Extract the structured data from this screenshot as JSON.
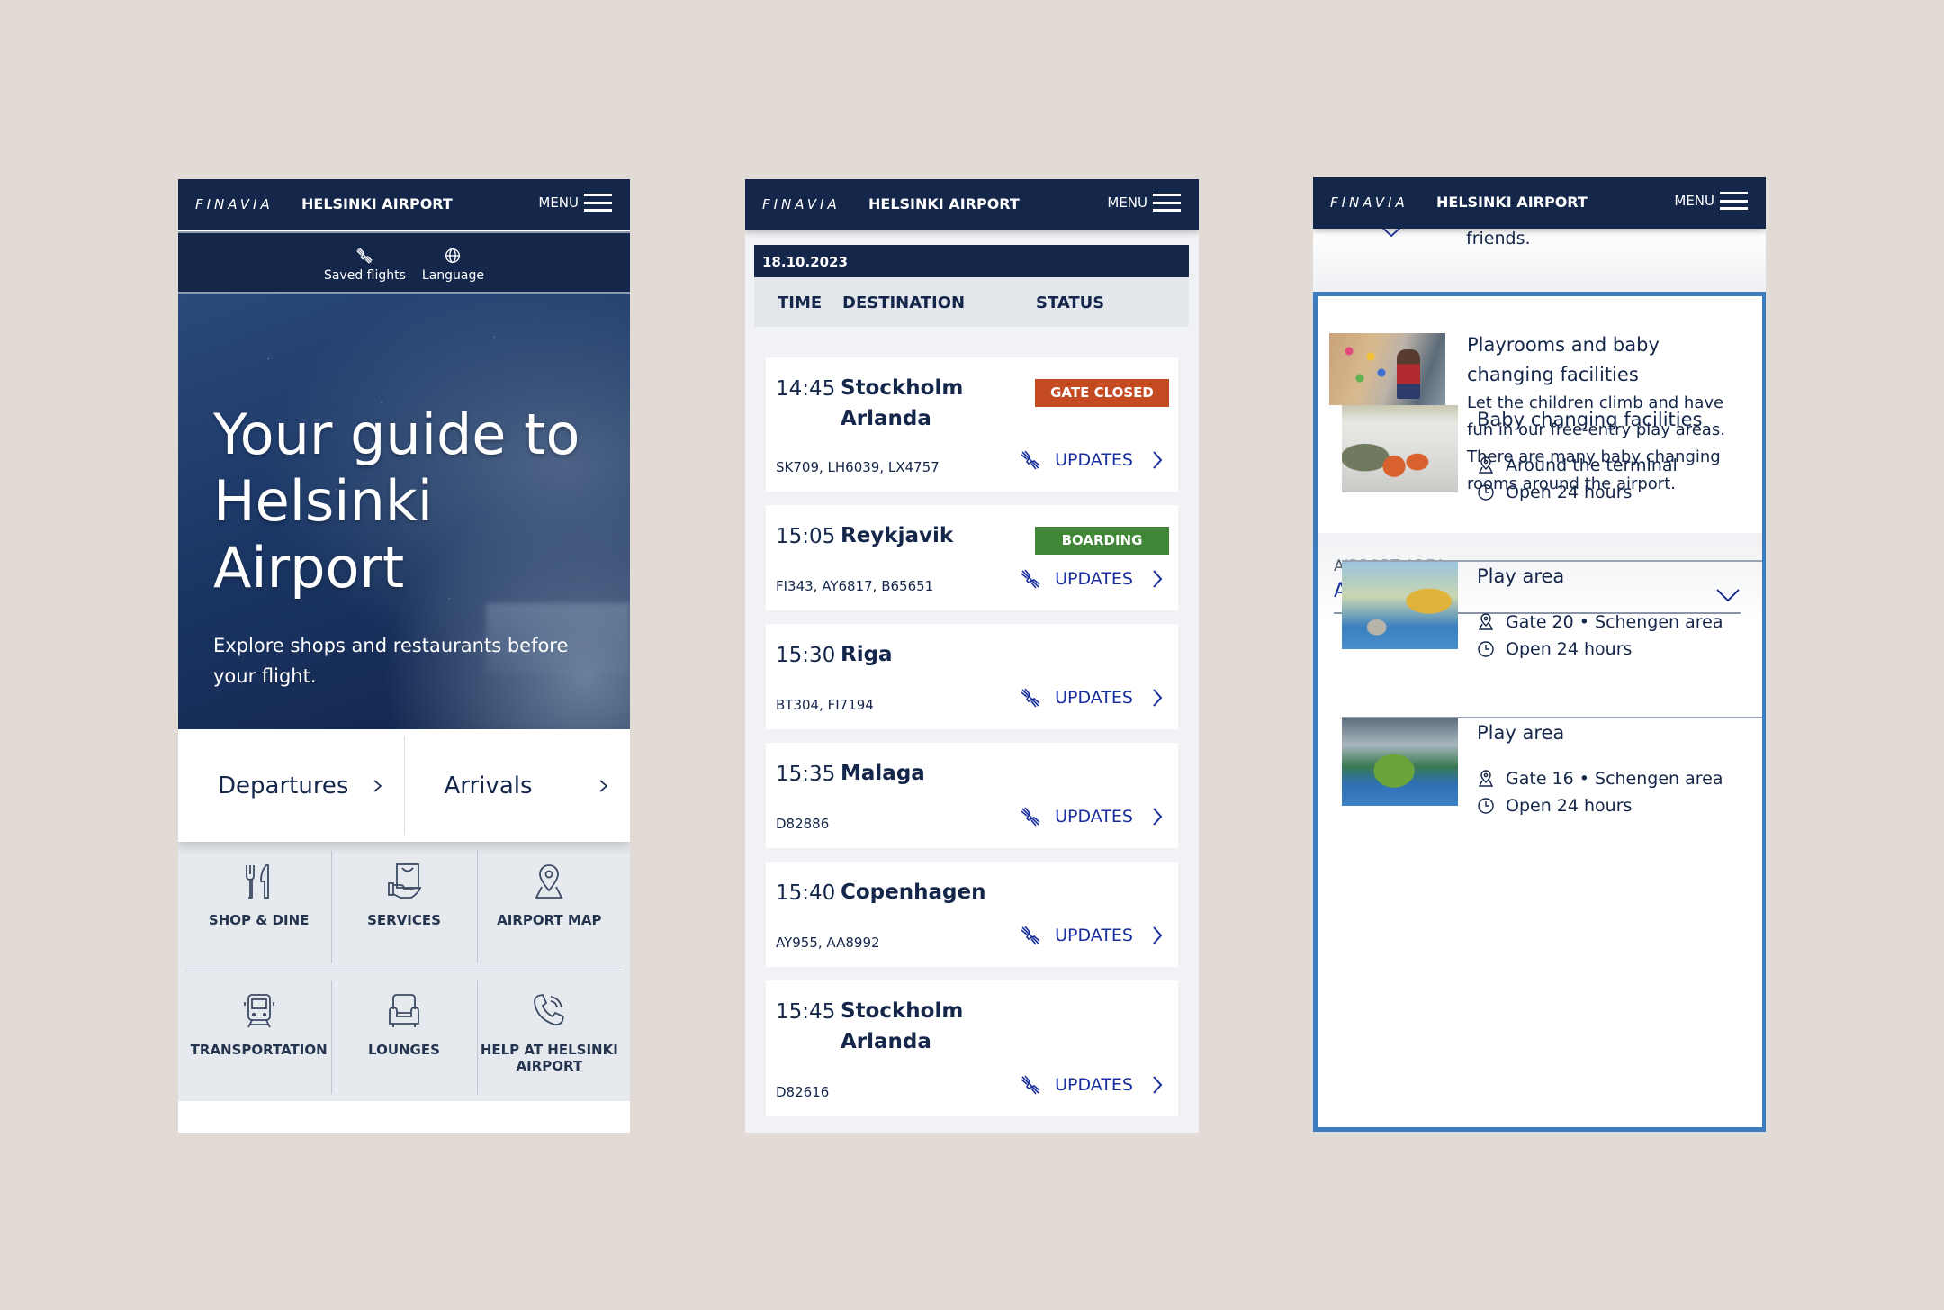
{
  "brand": {
    "logo": "FINAVIA",
    "site": "HELSINKI AIRPORT",
    "menu": "MENU"
  },
  "home": {
    "toolbar": [
      {
        "label": "Saved flights",
        "icon": "saved-flights-icon"
      },
      {
        "label": "Language",
        "icon": "globe-icon"
      }
    ],
    "hero": {
      "title": "Your guide to Helsinki Airport",
      "subtitle": "Explore shops and restaurants before your flight."
    },
    "quick_links": [
      {
        "label": "Departures"
      },
      {
        "label": "Arrivals"
      }
    ],
    "tiles": [
      {
        "label": "SHOP & DINE",
        "icon": "fork-knife-icon"
      },
      {
        "label": "SERVICES",
        "icon": "shopping-bag-hand-icon"
      },
      {
        "label": "AIRPORT MAP",
        "icon": "map-pin-icon"
      },
      {
        "label": "TRANSPORTATION",
        "icon": "train-icon"
      },
      {
        "label": "LOUNGES",
        "icon": "armchair-icon"
      },
      {
        "label": "HELP AT HELSINKI AIRPORT",
        "icon": "phone-icon"
      }
    ]
  },
  "departures": {
    "date": "18.10.2023",
    "columns": {
      "time": "TIME",
      "destination": "DESTINATION",
      "status": "STATUS"
    },
    "updates_label": "UPDATES",
    "flights": [
      {
        "time": "14:45",
        "destination": "Stockholm Arlanda",
        "codes": "SK709, LH6039, LX4757",
        "status": "GATE CLOSED",
        "status_color": "#c44a22"
      },
      {
        "time": "15:05",
        "destination": "Reykjavik",
        "codes": "FI343, AY6817, B65651",
        "status": "BOARDING",
        "status_color": "#3f8636"
      },
      {
        "time": "15:30",
        "destination": "Riga",
        "codes": "BT304, FI7194",
        "status": "",
        "status_color": ""
      },
      {
        "time": "15:35",
        "destination": "Malaga",
        "codes": "D82886",
        "status": "",
        "status_color": ""
      },
      {
        "time": "15:40",
        "destination": "Copenhagen",
        "codes": "AY955, AA8992",
        "status": "",
        "status_color": ""
      },
      {
        "time": "15:45",
        "destination": "Stockholm Arlanda",
        "codes": "D82616",
        "status": "",
        "status_color": ""
      }
    ]
  },
  "family": {
    "previous_text": "friends.",
    "intro": {
      "title": "Playrooms and baby changing facilities",
      "body": "Let the children climb and have fun in our free-entry play areas. There are many baby changing rooms around the airport."
    },
    "area_filter": {
      "label": "AIRPORT AREA",
      "value": "All areas"
    },
    "facilities": [
      {
        "title": "Baby changing facilities",
        "location": "Around the terminal",
        "hours": "Open 24 hours"
      },
      {
        "title": "Play area",
        "location": "Gate 20 • Schengen area",
        "hours": "Open 24 hours"
      },
      {
        "title": "Play area",
        "location": "Gate 16 • Schengen area",
        "hours": "Open 24 hours"
      }
    ]
  },
  "colors": {
    "navy": "#14264a",
    "link_blue": "#1a2f9c",
    "frame_blue": "#3d7cbf",
    "gate_closed": "#c44a22",
    "boarding": "#3f8636",
    "background": "#e1dad5"
  }
}
